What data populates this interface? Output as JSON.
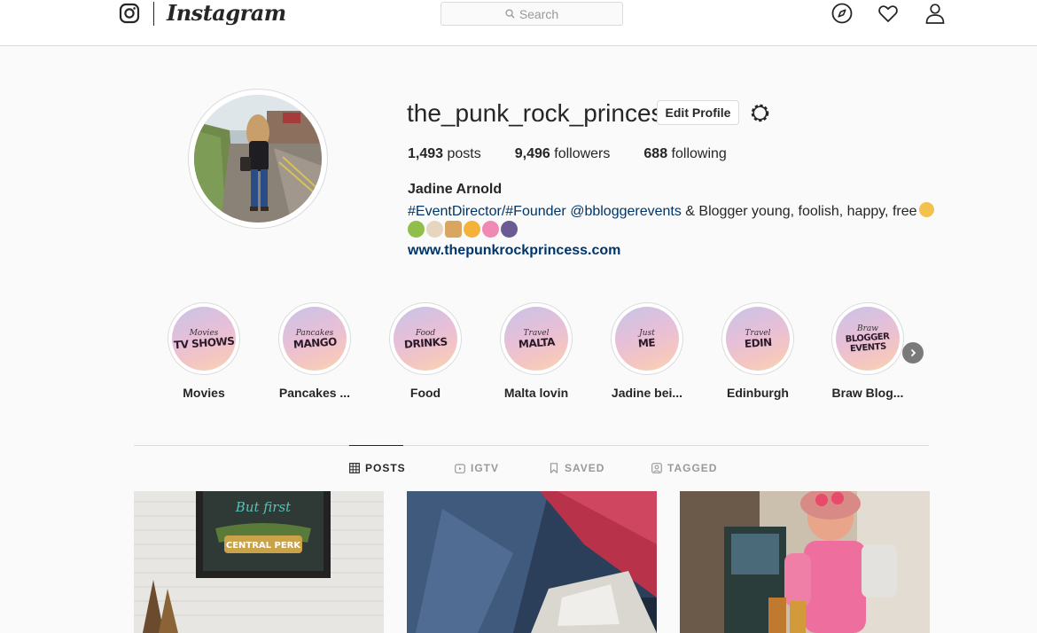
{
  "header": {
    "wordmark": "Instagram",
    "search_placeholder": "Search"
  },
  "profile": {
    "username": "the_punk_rock_princess",
    "edit_button": "Edit Profile",
    "stats": [
      {
        "count": "1,493",
        "label": "posts"
      },
      {
        "count": "9,496",
        "label": "followers"
      },
      {
        "count": "688",
        "label": "following"
      }
    ],
    "full_name": "Jadine Arnold",
    "bio_tags": "#EventDirector/#Founder @bbloggerevents",
    "bio_text": " & Blogger young, foolish, happy, free",
    "website": "www.thepunkrockprincess.com"
  },
  "highlights": [
    {
      "small": "Movies",
      "big": "TV SHOWS",
      "label": "Movies"
    },
    {
      "small": "Pancakes",
      "big": "MANGO",
      "label": "Pancakes ..."
    },
    {
      "small": "Food",
      "big": "DRINKS",
      "label": "Food"
    },
    {
      "small": "Travel",
      "big": "MALTA",
      "label": "Malta lovin"
    },
    {
      "small": "Just",
      "big": "ME",
      "label": "Jadine bei..."
    },
    {
      "small": "Travel",
      "big": "EDIN",
      "label": "Edinburgh"
    },
    {
      "small": "Braw",
      "big": "BLOGGER EVENTS",
      "label": "Braw Blog..."
    }
  ],
  "tabs": [
    {
      "label": "POSTS",
      "active": true
    },
    {
      "label": "IGTV",
      "active": false
    },
    {
      "label": "SAVED",
      "active": false
    },
    {
      "label": "TAGGED",
      "active": false
    }
  ],
  "posts": [
    {
      "sign_small": "But first",
      "sign_big": "CENTRAL PERK"
    },
    {
      "caption": ""
    },
    {
      "caption": ""
    }
  ],
  "colors": {
    "link": "#003569",
    "border": "#dbdbdb",
    "text": "#262626",
    "muted": "#999999"
  }
}
